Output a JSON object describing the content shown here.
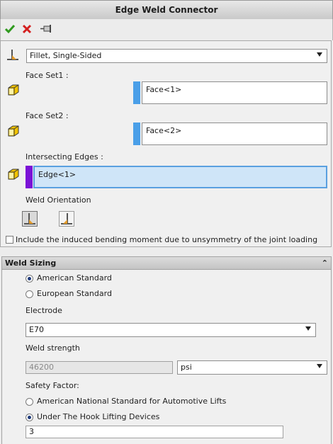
{
  "window": {
    "title": "Edge Weld Connector"
  },
  "toolbar": {
    "ok_icon": "checkmark-icon",
    "cancel_icon": "close-icon",
    "pin_icon": "pushpin-icon"
  },
  "weld_type": {
    "selected": "Fillet, Single-Sided"
  },
  "face_set1": {
    "label": "Face Set1 :",
    "value": "Face<1>",
    "color": "#4a9fe8"
  },
  "face_set2": {
    "label": "Face Set2 :",
    "value": "Face<2>",
    "color": "#4a9fe8"
  },
  "intersecting_edges": {
    "label": "Intersecting Edges :",
    "value": "Edge<1>",
    "color": "#7b12d6"
  },
  "weld_orientation": {
    "label": "Weld Orientation"
  },
  "bending_moment": {
    "label": "Include the induced bending moment due to unsymmetry of the joint loading",
    "checked": false
  },
  "weld_sizing": {
    "header": "Weld Sizing",
    "standards": [
      "American Standard",
      "European Standard"
    ],
    "selected_standard": "American Standard",
    "electrode_label": "Electrode",
    "electrode_value": "E70",
    "strength_label": "Weld strength",
    "strength_value": "46200",
    "strength_unit": "psi",
    "safety_label": "Safety Factor:",
    "safety_options": [
      "American National Standard for Automotive Lifts",
      "Under The Hook Lifting Devices"
    ],
    "selected_safety": "Under The Hook Lifting Devices",
    "safety_value": "3"
  }
}
